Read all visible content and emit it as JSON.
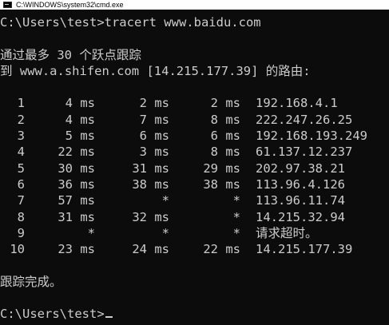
{
  "window": {
    "title": "C:\\WINDOWS\\system32\\cmd.exe",
    "app_icon": "cmd-icon"
  },
  "console": {
    "command_line": "C:\\Users\\test>tracert www.baidu.com",
    "header_line1": "通过最多 30 个跃点跟踪",
    "header_line2": "到 www.a.shifen.com [14.215.177.39] 的路由:",
    "hops": [
      {
        "hop": "1",
        "rtt1": "4 ms",
        "rtt2": "2 ms",
        "rtt3": "2 ms",
        "host": "192.168.4.1"
      },
      {
        "hop": "2",
        "rtt1": "4 ms",
        "rtt2": "7 ms",
        "rtt3": "8 ms",
        "host": "222.247.26.25"
      },
      {
        "hop": "3",
        "rtt1": "5 ms",
        "rtt2": "6 ms",
        "rtt3": "6 ms",
        "host": "192.168.193.249"
      },
      {
        "hop": "4",
        "rtt1": "22 ms",
        "rtt2": "3 ms",
        "rtt3": "8 ms",
        "host": "61.137.12.237"
      },
      {
        "hop": "5",
        "rtt1": "30 ms",
        "rtt2": "31 ms",
        "rtt3": "29 ms",
        "host": "202.97.38.21"
      },
      {
        "hop": "6",
        "rtt1": "36 ms",
        "rtt2": "38 ms",
        "rtt3": "38 ms",
        "host": "113.96.4.126"
      },
      {
        "hop": "7",
        "rtt1": "57 ms",
        "rtt2": "*",
        "rtt3": "*",
        "host": "113.96.11.74"
      },
      {
        "hop": "8",
        "rtt1": "31 ms",
        "rtt2": "32 ms",
        "rtt3": "*",
        "host": "14.215.32.94"
      },
      {
        "hop": "9",
        "rtt1": "*",
        "rtt2": "*",
        "rtt3": "*",
        "host": "请求超时。"
      },
      {
        "hop": "10",
        "rtt1": "23 ms",
        "rtt2": "24 ms",
        "rtt3": "22 ms",
        "host": "14.215.177.39"
      }
    ],
    "trace_complete": "跟踪完成。",
    "prompt": "C:\\Users\\test>"
  }
}
